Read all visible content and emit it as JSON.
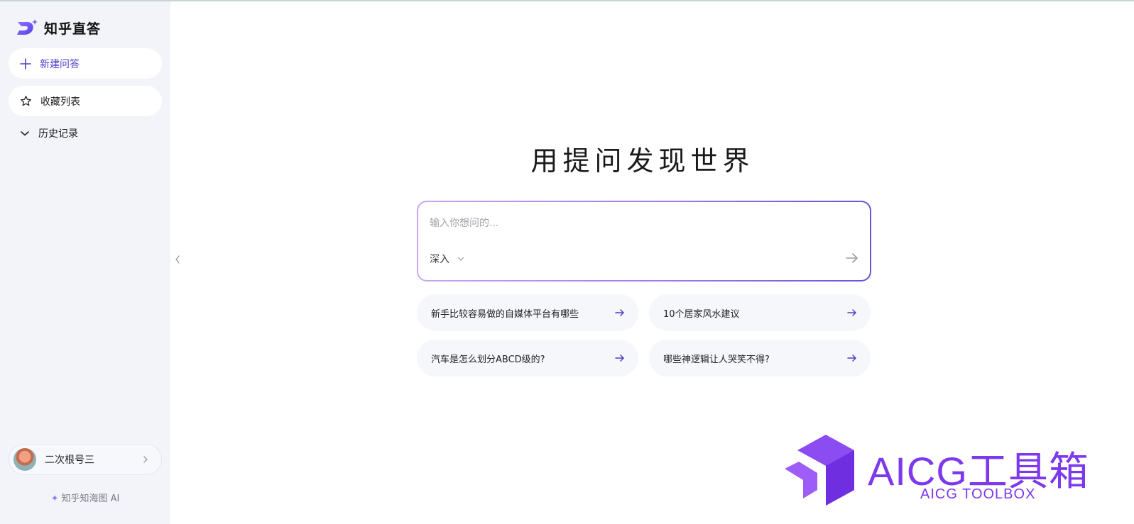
{
  "app": {
    "brand_name": "知乎直答",
    "accent_color": "#4b3fc9"
  },
  "sidebar": {
    "new_qa": {
      "label": "新建问答",
      "icon": "plus-icon"
    },
    "favorites": {
      "label": "收藏列表",
      "icon": "star-icon"
    },
    "history": {
      "label": "历史记录",
      "icon": "chevron-down-icon"
    },
    "user": {
      "name": "二次根号三",
      "icon": "chevron-right-icon"
    },
    "powered_by": "知乎知海图 AI"
  },
  "main": {
    "headline": "用提问发现世界",
    "ask": {
      "placeholder": "输入你想问的...",
      "mode": "深入"
    },
    "suggestions": [
      "新手比较容易做的自媒体平台有哪些",
      "10个居家风水建议",
      "汽车是怎么划分ABCD级的?",
      "哪些神逻辑让人哭笑不得?"
    ]
  },
  "watermark": {
    "title": "AICG工具箱",
    "subtitle": "AICG TOOLBOX",
    "color": "#7c39ee"
  }
}
